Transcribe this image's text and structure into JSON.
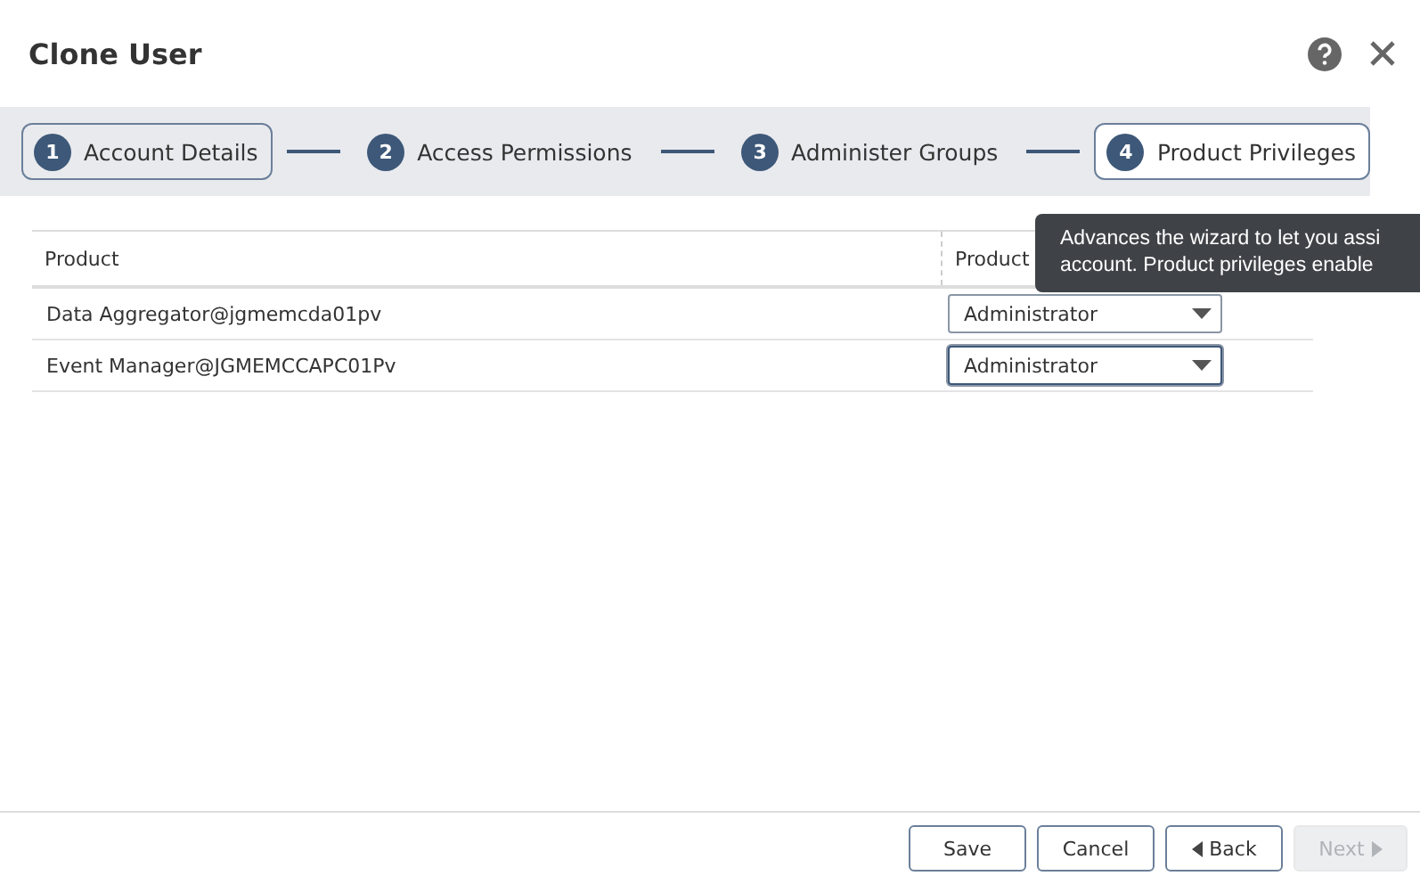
{
  "dialog": {
    "title": "Clone User"
  },
  "steps": [
    {
      "number": "1",
      "label": "Account Details",
      "selected": false,
      "focused": true
    },
    {
      "number": "2",
      "label": "Access Permissions",
      "selected": false,
      "focused": false
    },
    {
      "number": "3",
      "label": "Administer Groups",
      "selected": false,
      "focused": false
    },
    {
      "number": "4",
      "label": "Product Privileges",
      "selected": true,
      "focused": false
    }
  ],
  "table": {
    "columns": [
      "Product",
      "Product"
    ],
    "rows": [
      {
        "product": "Data Aggregator@jgmemcda01pv",
        "privilege": "Administrator",
        "focused": false
      },
      {
        "product": "Event Manager@JGMEMCCAPC01Pv",
        "privilege": "Administrator",
        "focused": true
      }
    ]
  },
  "tooltip": {
    "lines": [
      "Advances the wizard to let you assi",
      "account. Product privileges enable"
    ]
  },
  "buttons": [
    {
      "label": "Save",
      "kind": "plain",
      "disabled": false
    },
    {
      "label": "Cancel",
      "kind": "plain",
      "disabled": false
    },
    {
      "label": "Back",
      "kind": "back",
      "disabled": false
    },
    {
      "label": "Next",
      "kind": "next",
      "disabled": true
    }
  ]
}
